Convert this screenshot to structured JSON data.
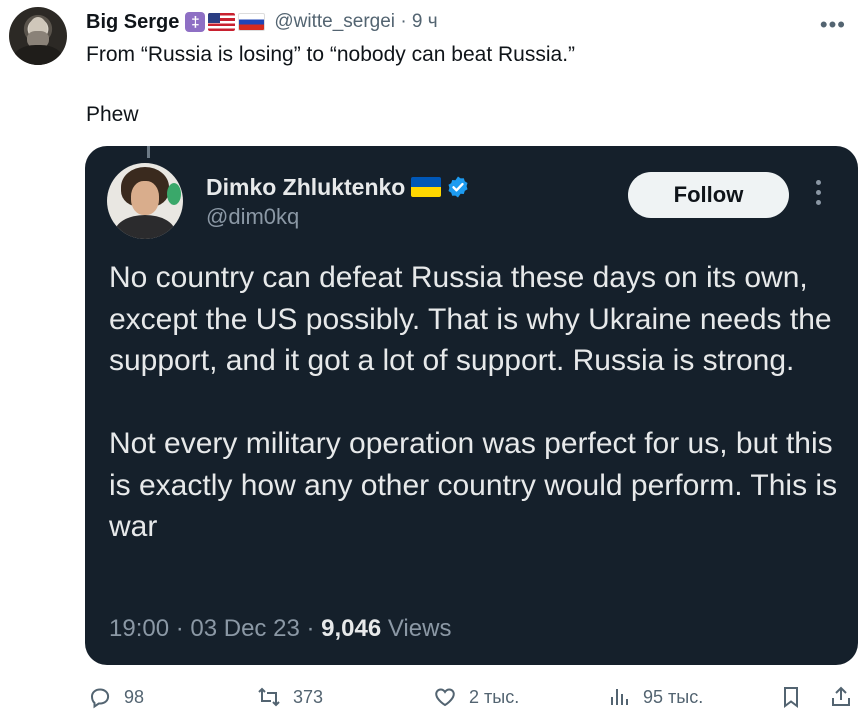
{
  "tweet": {
    "author_name": "Big Serge",
    "badges": [
      "orthodox-cross-badge",
      "us-flag-emoji",
      "russia-flag-emoji"
    ],
    "badge_cross_glyph": "‡",
    "handle": "@witte_sergei",
    "separator": "·",
    "time": "9 ч",
    "text": "From “Russia is losing” to “nobody can beat Russia.”\n\nPhew"
  },
  "quoted": {
    "author_name": "Dimko Zhluktenko",
    "handle": "@dim0kq",
    "follow_label": "Follow",
    "text": "No country can defeat Russia these days on its own, except the US possibly. That is why Ukraine needs the support, and it got a lot of support. Russia is strong.\n\nNot every military operation was perfect for us, but this is exactly how any other country would perform. This is war",
    "time": "19:00 · 03 Dec 23 · ",
    "views_count": "9,046",
    "views_label": " Views",
    "colors": {
      "card_bg": "#15202b",
      "verified": "#1d9bf0"
    }
  },
  "actions": {
    "replies": "98",
    "retweets": "373",
    "likes": "2 тыс.",
    "views": "95 тыс."
  }
}
